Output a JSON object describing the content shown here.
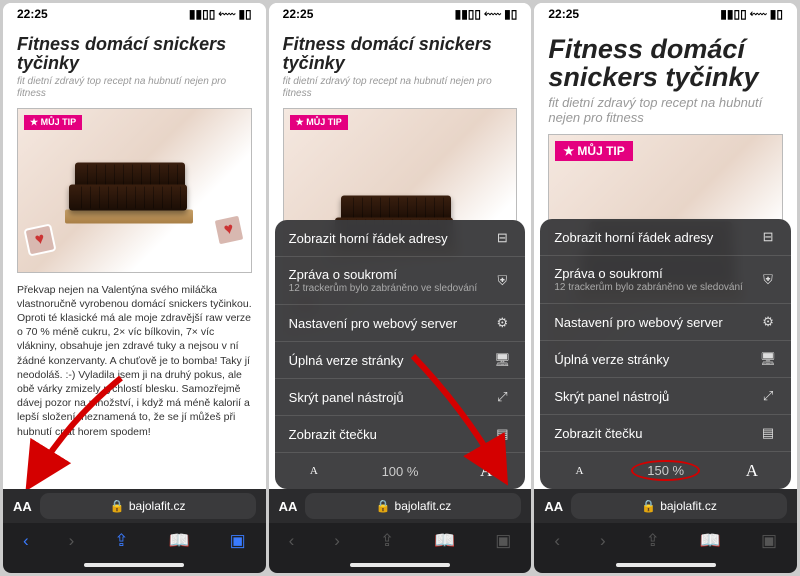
{
  "time": "22:25",
  "article": {
    "title": "Fitness domácí snickers tyčinky",
    "subtitle": "fit dietní zdravý top recept na hubnutí nejen pro fitness",
    "tip": "★ MŮJ TIP",
    "body": "Překvap nejen na Valentýna svého miláčka vlastnoručně vyrobenou domácí snickers tyčinkou. Oproti té klasické má ale moje zdravější raw verze o 70 % méně cukru, 2× víc bílkovin, 7× víc vlákniny, obsahuje jen zdravé tuky a nejsou v ní žádné konzervanty. A chuťově je to bomba! Taky jí neodoláš. :-) Vyladila jsem ji na druhý pokus, ale obě várky zmizely rychlostí blesku. Samozřejmě dávej pozor na množství, i když má méně kalorií a lepší složení, neznamená to, že se jí můžeš při hubnutí cpát horem spodem!"
  },
  "menu": {
    "items": [
      {
        "label": "Zobrazit horní řádek adresy",
        "icon": "⊟"
      },
      {
        "label": "Zpráva o soukromí",
        "sub": "12 trackerům bylo zabráněno ve sledování",
        "icon": "⛨"
      },
      {
        "label": "Nastavení pro webový server",
        "icon": "⚙"
      },
      {
        "label": "Úplná verze stránky",
        "icon": "🖥"
      },
      {
        "label": "Skrýt panel nástrojů",
        "icon": "⤢"
      },
      {
        "label": "Zobrazit čtečku",
        "icon": "▤"
      }
    ],
    "zoom_a": "100 %",
    "zoom_b": "150 %"
  },
  "safari": {
    "aa": "AA",
    "lock": "🔒",
    "domain": "bajolafit.cz"
  }
}
